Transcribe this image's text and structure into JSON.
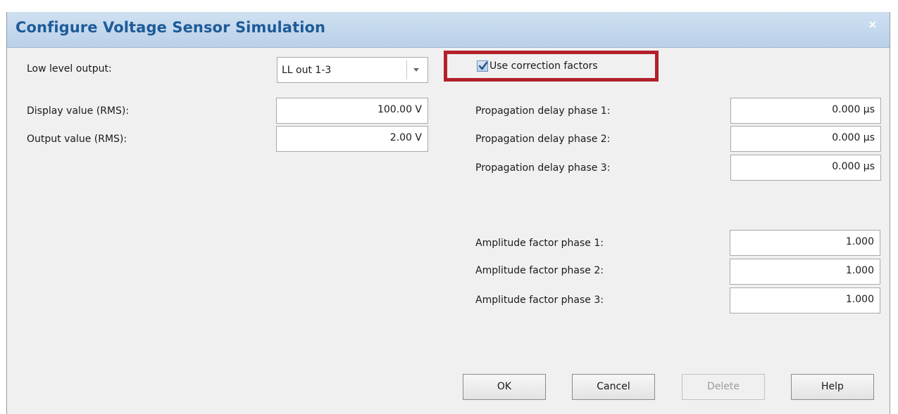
{
  "dialog": {
    "title": "Configure Voltage Sensor Simulation",
    "close_symbol": "×"
  },
  "left": {
    "low_level_output_label": "Low level output:",
    "low_level_output_value": "LL out 1-3",
    "display_value_label": "Display value (RMS):",
    "display_value": "100.00 V",
    "output_value_label": "Output value (RMS):",
    "output_value": "2.00 V"
  },
  "correction": {
    "checkbox_label": "Use correction factors",
    "checked": true,
    "highlight_color": "#b3202a",
    "propagation_delays": [
      {
        "label": "Propagation delay phase 1:",
        "value": "0.000 µs"
      },
      {
        "label": "Propagation delay phase 2:",
        "value": "0.000 µs"
      },
      {
        "label": "Propagation delay phase 3:",
        "value": "0.000 µs"
      }
    ],
    "amplitude_factors": [
      {
        "label": "Amplitude factor phase 1:",
        "value": "1.000"
      },
      {
        "label": "Amplitude factor phase 2:",
        "value": "1.000"
      },
      {
        "label": "Amplitude factor phase 3:",
        "value": "1.000"
      }
    ]
  },
  "buttons": {
    "ok": "OK",
    "cancel": "Cancel",
    "delete": "Delete",
    "help": "Help"
  },
  "colors": {
    "title_text": "#1e5b98",
    "titlebar_bg": "#c4d8ee",
    "dialog_bg": "#f0f0f0"
  }
}
